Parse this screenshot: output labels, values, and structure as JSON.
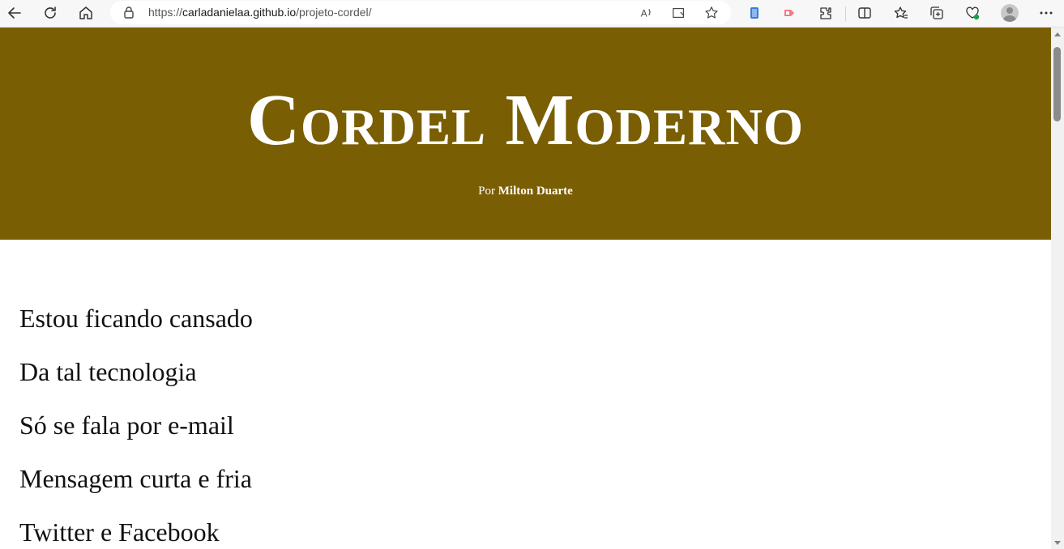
{
  "browser": {
    "url_scheme": "https://",
    "url_host": "carladanielaa.github.io",
    "url_path": "/projeto-cordel/",
    "icons": [
      "back-icon",
      "refresh-icon",
      "home-icon",
      "lock-icon",
      "read-aloud-icon",
      "immersive-reader-icon",
      "favorite-star-icon",
      "extension-blue-icon",
      "extension-red-icon",
      "extensions-icon",
      "split-screen-icon",
      "favorites-icon",
      "collections-icon",
      "browser-essentials-icon",
      "profile-avatar",
      "more-icon"
    ]
  },
  "header": {
    "title": "Cordel Moderno",
    "byline_prefix": "Por",
    "author": "Milton Duarte",
    "background": "#7a5e04"
  },
  "poem": {
    "lines": [
      "Estou ficando cansado",
      "Da tal tecnologia",
      "Só se fala por e-mail",
      "Mensagem curta e fria",
      "Twitter e Facebook"
    ]
  }
}
